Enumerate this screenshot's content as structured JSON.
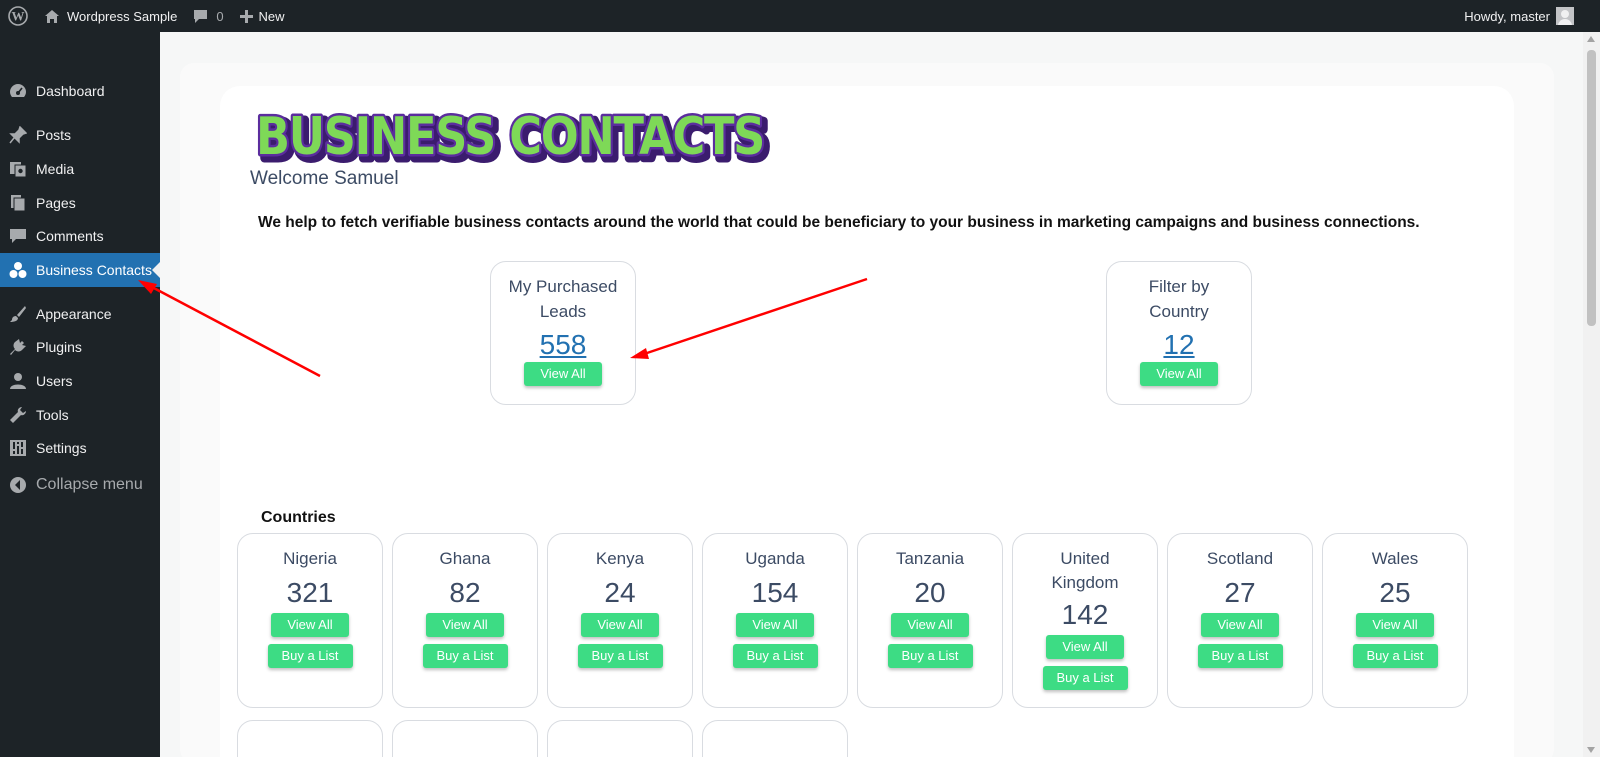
{
  "adminbar": {
    "site_name": "Wordpress Sample",
    "comments_count": "0",
    "new_label": "New",
    "howdy": "Howdy, master"
  },
  "sidebar": {
    "items": [
      {
        "label": "Dashboard",
        "icon": "dashboard-icon"
      },
      {
        "label": "Posts",
        "icon": "pin-icon"
      },
      {
        "label": "Media",
        "icon": "media-icon"
      },
      {
        "label": "Pages",
        "icon": "pages-icon"
      },
      {
        "label": "Comments",
        "icon": "comment-icon"
      },
      {
        "label": "Business Contacts",
        "icon": "groups-icon",
        "current": true
      },
      {
        "label": "Appearance",
        "icon": "brush-icon"
      },
      {
        "label": "Plugins",
        "icon": "plugin-icon"
      },
      {
        "label": "Users",
        "icon": "user-icon"
      },
      {
        "label": "Tools",
        "icon": "wrench-icon"
      },
      {
        "label": "Settings",
        "icon": "settings-icon"
      },
      {
        "label": "Collapse menu",
        "icon": "collapse-icon"
      }
    ]
  },
  "main": {
    "logo_text": "BUSINESS CONTACTS",
    "welcome": "Welcome Samuel",
    "tagline": "We help to fetch verifiable business contacts around the world that could be beneficiary to your business in marketing campaigns and business connections.",
    "summary_cards": [
      {
        "title_line1": "My Purchased",
        "title_line2": "Leads",
        "count": "558",
        "button": "View All"
      },
      {
        "title_line1": "Filter by",
        "title_line2": "Country",
        "count": "12",
        "button": "View All"
      }
    ],
    "countries_label": "Countries",
    "countries": [
      {
        "name": "Nigeria",
        "count": "321",
        "view": "View All",
        "buy": "Buy a List"
      },
      {
        "name": "Ghana",
        "count": "82",
        "view": "View All",
        "buy": "Buy a List"
      },
      {
        "name": "Kenya",
        "count": "24",
        "view": "View All",
        "buy": "Buy a List"
      },
      {
        "name": "Uganda",
        "count": "154",
        "view": "View All",
        "buy": "Buy a List"
      },
      {
        "name": "Tanzania",
        "count": "20",
        "view": "View All",
        "buy": "Buy a List"
      },
      {
        "name": "United Kingdom",
        "name_line1": "United",
        "name_line2": "Kingdom",
        "count": "142",
        "view": "View All",
        "buy": "Buy a List"
      },
      {
        "name": "Scotland",
        "count": "27",
        "view": "View All",
        "buy": "Buy a List"
      },
      {
        "name": "Wales",
        "count": "25",
        "view": "View All",
        "buy": "Buy a List"
      }
    ]
  },
  "colors": {
    "adminbar_bg": "#1d2327",
    "menu_current_bg": "#2271b1",
    "button_green": "#3ddc84",
    "logo_fill": "#7ed957",
    "logo_outline": "#5b2d9e",
    "annotation_arrow": "#ff0000"
  }
}
